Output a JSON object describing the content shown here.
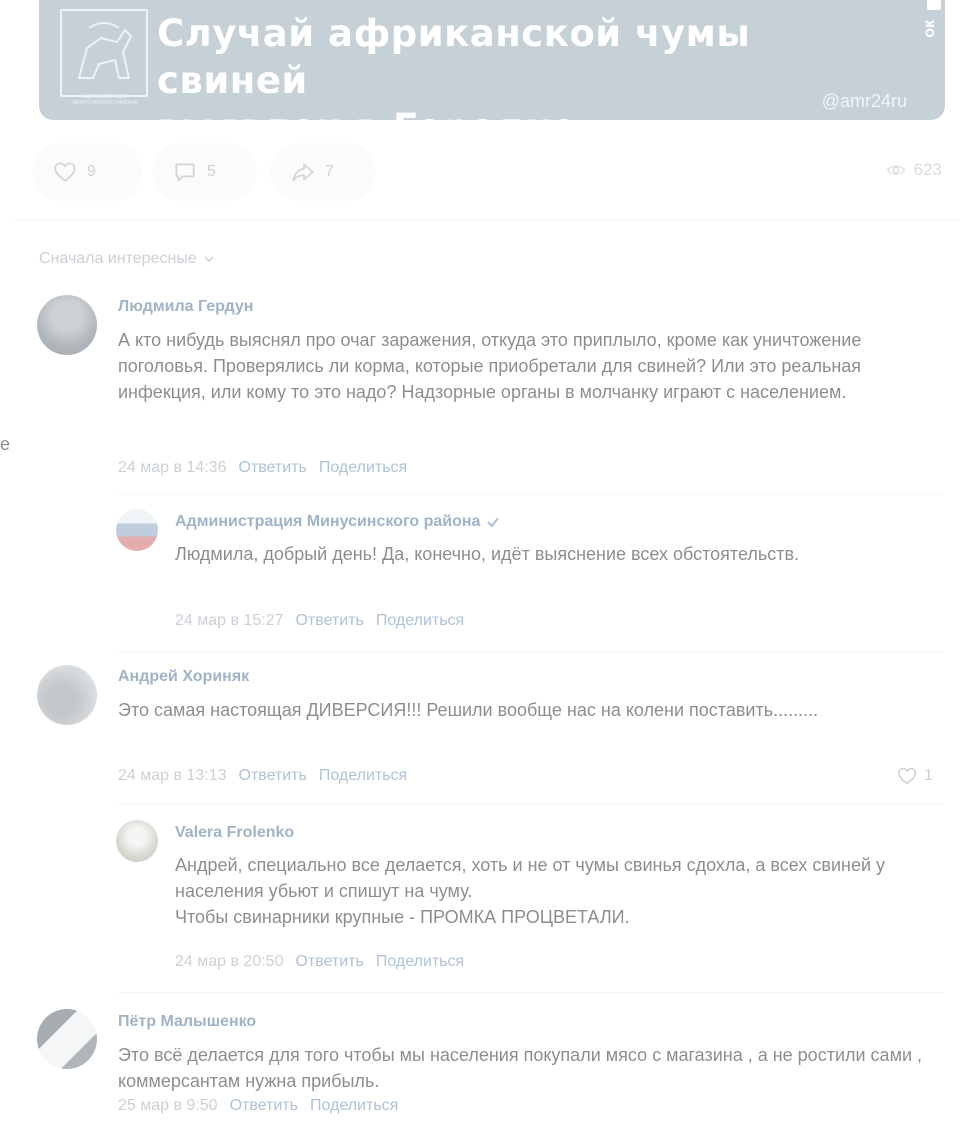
{
  "post": {
    "banner_title_line1": "Случай африканской чумы свиней",
    "banner_title_line2": "выявлен в Городке",
    "banner_handle": "@amr24ru",
    "banner_side_text": "ок",
    "logo_caption": "АДМИНИСТРАЦИЯ МИНУСИНСКОГО РАЙОНА",
    "likes": "9",
    "comments": "5",
    "shares": "7",
    "views": "623"
  },
  "edge_fragment": "е",
  "sort": {
    "label": "Сначала интересные"
  },
  "comments": [
    {
      "author": "Людмила Гердун",
      "text": "А кто нибудь выяснял про очаг заражения, откуда это приплыло, кроме как уничтожение поголовья. Проверялись ли корма, которые приобретали для свиней? Или это реальная инфекция, или кому то это надо? Надзорные органы в молчанку играют с населением.",
      "date": "24 мар в 14:36",
      "reply": "Ответить",
      "share": "Поделиться"
    },
    {
      "author": "Администрация Минусинского района",
      "text": "Людмила, добрый день! Да, конечно, идёт выяснение всех обстоятельств.",
      "date": "24 мар в 15:27",
      "reply": "Ответить",
      "share": "Поделиться"
    },
    {
      "author": "Андрей Хориняк",
      "text": "Это самая настоящая ДИВЕРСИЯ!!! Решили вообще нас на колени поставить.........",
      "date": "24 мар в 13:13",
      "reply": "Ответить",
      "share": "Поделиться",
      "likes": "1"
    },
    {
      "author": "Valera Frolenko",
      "text": "Андрей, специально все делается, хоть и не от чумы свинья сдохла, а всех свиней у населения убьют и спишут на чуму.\nЧтобы свинарники крупные - ПРОМКА ПРОЦВЕТАЛИ.",
      "date": "24 мар в 20:50",
      "reply": "Ответить",
      "share": "Поделиться"
    },
    {
      "author": "Пётр Малышенко",
      "text": "Это всё делается для того чтобы мы населения покупали мясо с магазина , а не ростили сами , коммерсантам нужна прибыль.",
      "date": "25 мар в 9:50",
      "reply": "Ответить",
      "share": "Поделиться"
    }
  ],
  "colors": {
    "banner": "#7f98a6",
    "author": "#2a5885",
    "link": "#4a76a8",
    "muted": "#8d98a4",
    "verified": "#4a76a8"
  }
}
